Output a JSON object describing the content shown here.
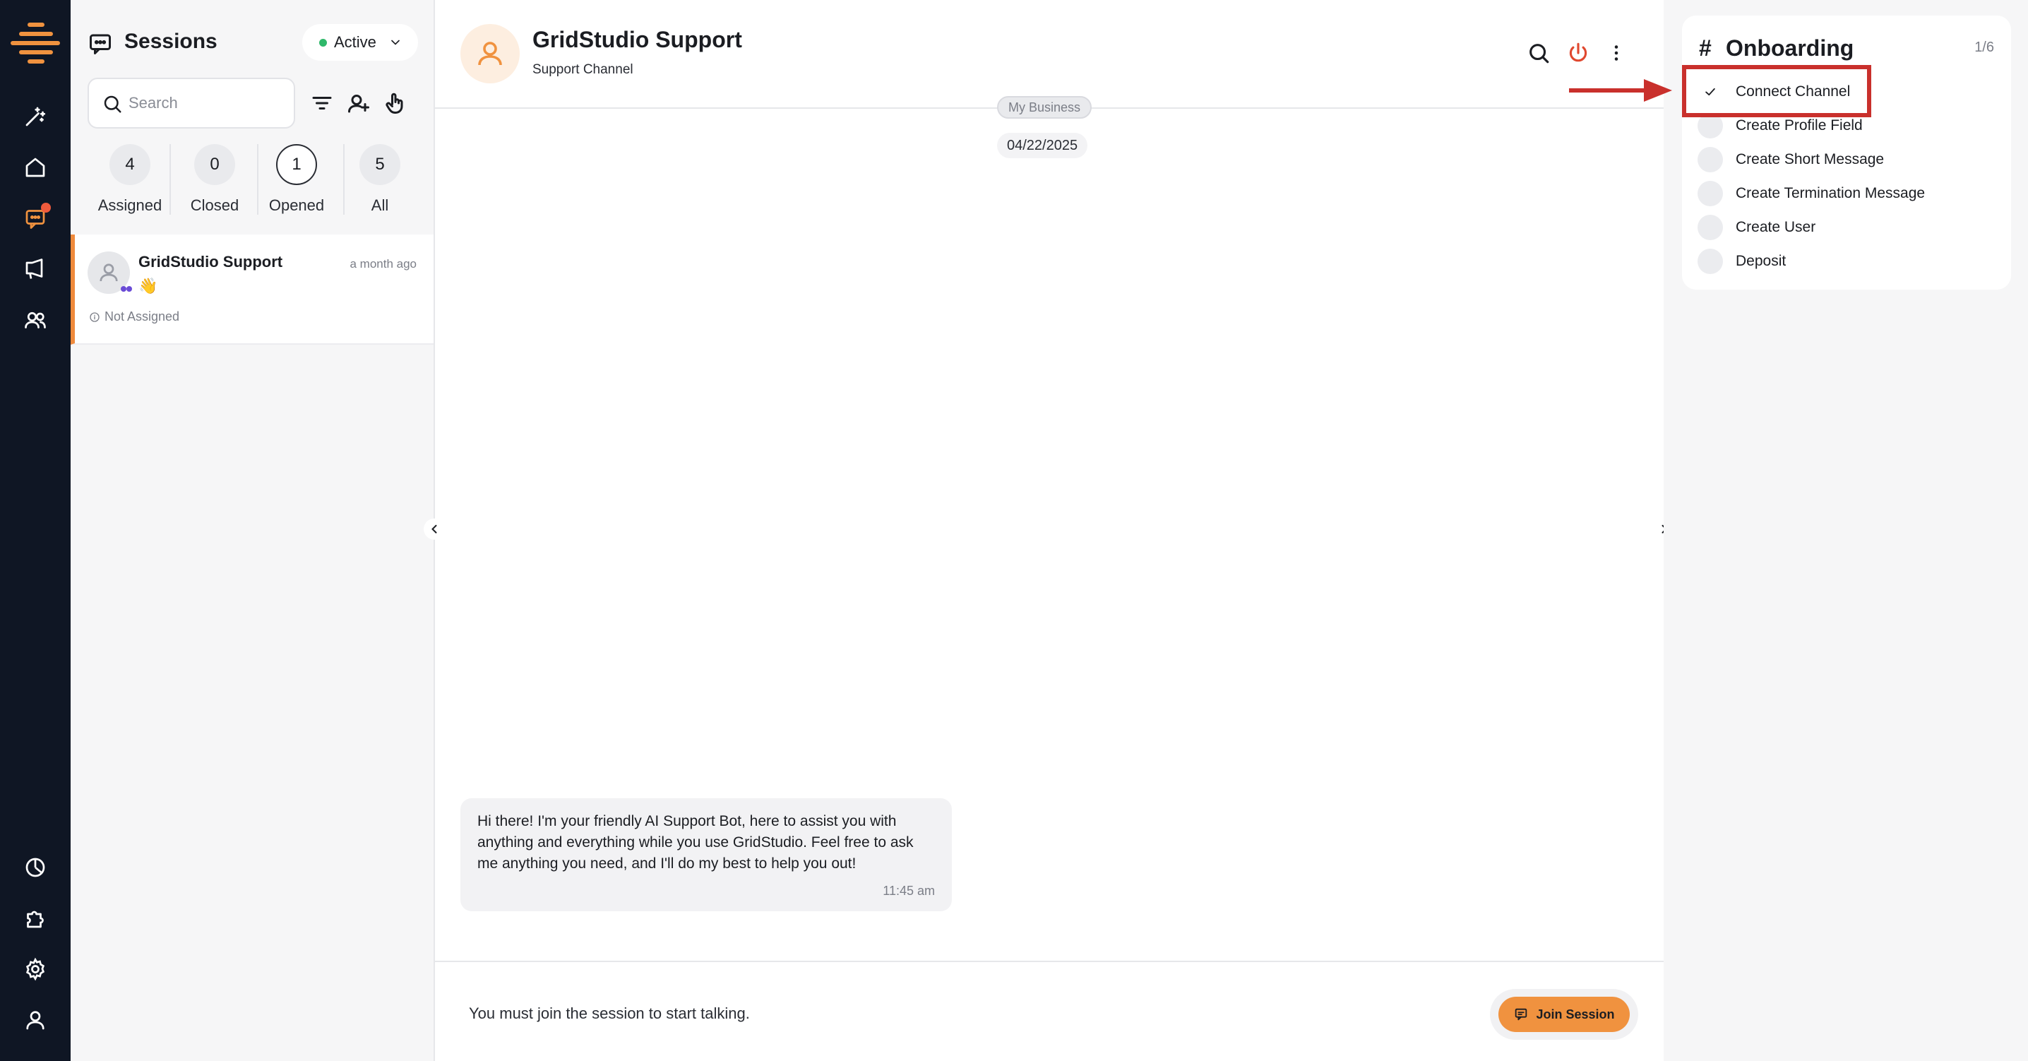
{
  "sessions": {
    "title": "Sessions",
    "status": "Active",
    "search_placeholder": "Search",
    "counts": [
      {
        "value": "4",
        "label": "Assigned"
      },
      {
        "value": "0",
        "label": "Closed"
      },
      {
        "value": "1",
        "label": "Opened"
      },
      {
        "value": "5",
        "label": "All"
      }
    ],
    "items": [
      {
        "name": "GridStudio Support",
        "time": "a month ago",
        "preview": "👋",
        "assignment": "Not Assigned"
      }
    ]
  },
  "chat": {
    "name": "GridStudio Support",
    "subtitle": "Support Channel",
    "business_chip": "My Business",
    "date_chip": "04/22/2025",
    "message": {
      "text": "Hi there! I'm your friendly AI Support Bot, here to assist you with anything and everything while you use GridStudio. Feel free to ask me anything you need, and I'll do my best to help you out!",
      "time": "11:45 am"
    },
    "footer_text": "You must join the session to start talking.",
    "join_label": "Join Session"
  },
  "onboarding": {
    "hash": "#",
    "title": "Onboarding",
    "progress": "1/6",
    "steps": [
      {
        "label": "Connect Channel",
        "done": true
      },
      {
        "label": "Create Profile Field",
        "done": false
      },
      {
        "label": "Create Short Message",
        "done": false
      },
      {
        "label": "Create Termination Message",
        "done": false
      },
      {
        "label": "Create User",
        "done": false
      },
      {
        "label": "Deposit",
        "done": false
      }
    ]
  },
  "colors": {
    "accent": "#f0923f",
    "rail": "#0f1624",
    "active_status": "#2fb86a",
    "highlight": "#c9302c",
    "power": "#e0482f"
  }
}
